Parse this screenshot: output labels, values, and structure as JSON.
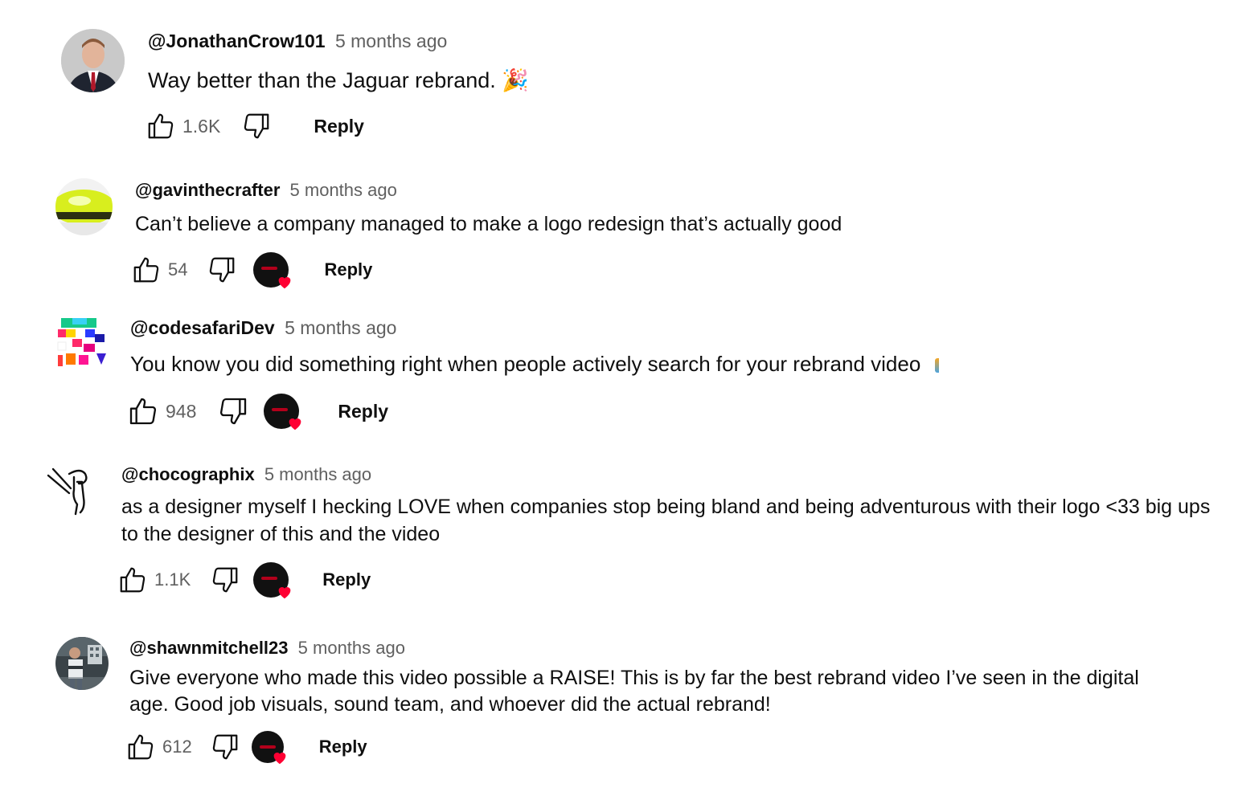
{
  "comments": [
    {
      "handle": "@JonathanCrow101",
      "time": "5 months ago",
      "text": "Way better than the Jaguar rebrand. 🎉",
      "likes": "1.6K",
      "reply_label": "Reply",
      "creator_hearted": false
    },
    {
      "handle": "@gavinthecrafter",
      "time": "5 months ago",
      "text": "Can’t believe a company managed to make a logo redesign that’s actually good",
      "likes": "54",
      "reply_label": "Reply",
      "creator_hearted": true
    },
    {
      "handle": "@codesafariDev",
      "time": "5 months ago",
      "text": "You know you did something right when people actively search for your rebrand video",
      "likes": "948",
      "reply_label": "Reply",
      "creator_hearted": true
    },
    {
      "handle": "@chocographix",
      "time": "5 months ago",
      "text": "as a designer myself I hecking LOVE when companies stop being bland and being adventurous with their logo <33 big ups to the designer of this and the video",
      "likes": "1.1K",
      "reply_label": "Reply",
      "creator_hearted": true
    },
    {
      "handle": "@shawnmitchell23",
      "time": "5 months ago",
      "text": "Give everyone who made this video possible a RAISE! This is by far the best rebrand video I’ve seen in the digital age. Good job visuals, sound team, and whoever did the actual rebrand!",
      "likes": "612",
      "reply_label": "Reply",
      "creator_hearted": true
    }
  ],
  "icons": {
    "like": "thumbs-up-icon",
    "dislike": "thumbs-down-icon",
    "heart": "heart-icon"
  },
  "colors": {
    "text": "#0f0f0f",
    "secondary": "#606060",
    "heart": "#ff0033"
  }
}
